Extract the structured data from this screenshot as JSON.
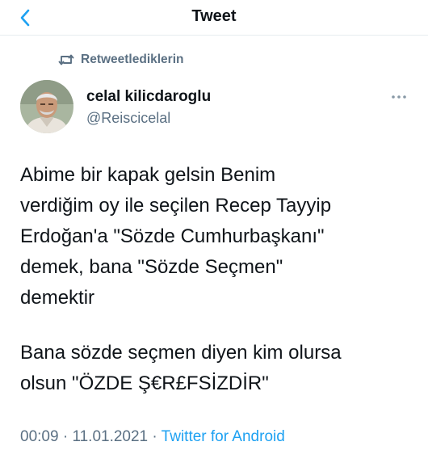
{
  "header": {
    "title": "Tweet",
    "back_icon": "chevron-left-icon",
    "accent_color": "#1da1f2"
  },
  "retweet": {
    "label": "Retweetlediklerin",
    "icon": "retweet-icon"
  },
  "author": {
    "name": "celal kilicdaroglu",
    "handle": "@Reiscicelal",
    "avatar_icon": "avatar-photo"
  },
  "more_icon": "more-horizontal-icon",
  "tweet": {
    "paragraph1": [
      "Abime bir kapak gelsin Benim",
      "verdiğim oy ile seçilen Recep Tayyip",
      "Erdoğan'a \"Sözde Cumhurbaşkanı\"",
      "demek, bana \"Sözde Seçmen\"",
      "demektir"
    ],
    "paragraph2": [
      "Bana sözde seçmen diyen kim olursa",
      "olsun \"ÖZDE Ş€R£FSİZDİR\""
    ]
  },
  "meta": {
    "time": "00:09",
    "separator1": " · ",
    "date": "11.01.2021",
    "separator2": " · ",
    "source": "Twitter for Android"
  }
}
